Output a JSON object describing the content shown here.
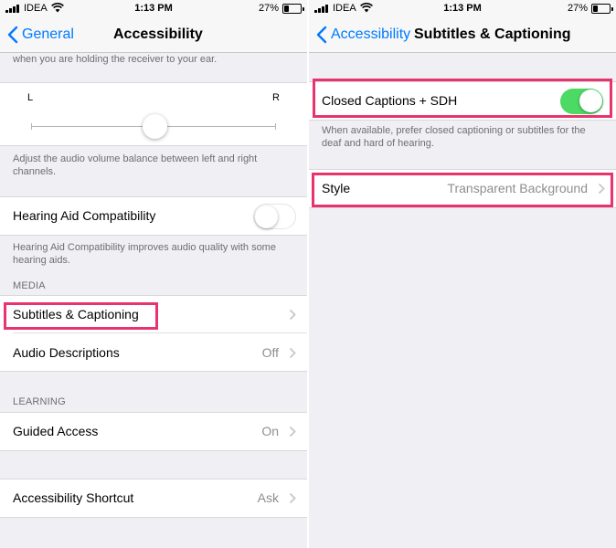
{
  "status_bar": {
    "carrier": "IDEA",
    "time": "1:13 PM",
    "battery": "27%"
  },
  "left": {
    "nav": {
      "back_label": "General",
      "title": "Accessibility"
    },
    "partial_text": "when you are holding the receiver to your ear.",
    "balance": {
      "left_label": "L",
      "right_label": "R",
      "value": 0.5
    },
    "balance_footer": "Adjust the audio volume balance between left and right channels.",
    "hearing_aid": {
      "label": "Hearing Aid Compatibility",
      "on": false
    },
    "hearing_aid_footer": "Hearing Aid Compatibility improves audio quality with some hearing aids.",
    "media_header": "MEDIA",
    "media_rows": [
      {
        "label": "Subtitles & Captioning",
        "value": ""
      },
      {
        "label": "Audio Descriptions",
        "value": "Off"
      }
    ],
    "learning_header": "LEARNING",
    "guided_access": {
      "label": "Guided Access",
      "value": "On"
    },
    "shortcut": {
      "label": "Accessibility Shortcut",
      "value": "Ask"
    }
  },
  "right": {
    "nav": {
      "back_label": "Accessibility",
      "title": "Subtitles & Captioning"
    },
    "cc": {
      "label": "Closed Captions + SDH",
      "on": true
    },
    "cc_footer": "When available, prefer closed captioning or subtitles for the deaf and hard of hearing.",
    "style": {
      "label": "Style",
      "value": "Transparent Background"
    }
  },
  "colors": {
    "accent": "#007aff",
    "toggle_on": "#4cd964",
    "highlight": "#e8336d",
    "background": "#efeff4"
  }
}
